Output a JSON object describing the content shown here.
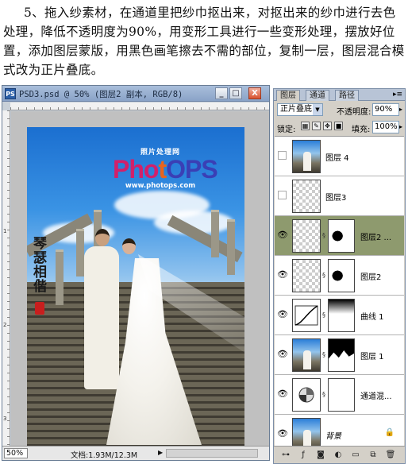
{
  "instruction": "5、拖入纱素材，在通道里把纱巾抠出来，对抠出来的纱巾进行去色处理，降低不透明度为90%，用变形工具进行一些变形处理，摆放好位置，添加图层蒙版，用黑色画笔擦去不需的部位，复制一层，图层混合模式改为正片叠底。",
  "document": {
    "icon_label": "PS",
    "title": "PSD3.psd @ 50% (图层2 副本, RGB/8)",
    "window_buttons": {
      "minimize": "_",
      "maximize": "□",
      "close": "X"
    },
    "rulers_top": [
      "2",
      "4",
      "6",
      "8",
      "10",
      "12",
      "14",
      "16",
      "18",
      "20",
      "22",
      "24",
      "26"
    ],
    "rulers_left": [
      "0",
      "1",
      "2",
      "3"
    ],
    "photo": {
      "logo_top": "照片处理网",
      "logo_main": [
        "Pho",
        "t",
        "OPS"
      ],
      "logo_url": "www.photops.com",
      "calligraphy": "琴瑟相偕"
    },
    "status": {
      "zoom": "50%",
      "doc_info": "文档:1.93M/12.3M",
      "arrow": "▶"
    }
  },
  "layers_panel": {
    "tabs": [
      "图层",
      "通道",
      "路径"
    ],
    "active_tab": 0,
    "menu_icon": "▸≡",
    "blend_mode": "正片叠底",
    "opacity_label": "不透明度:",
    "opacity": "90%",
    "lock_label": "锁定:",
    "fill_label": "填充:",
    "fill": "100%",
    "layers": [
      {
        "name": "图层 4",
        "visible": false,
        "thumb": "photo",
        "mask": null,
        "selected": false,
        "italic": false,
        "locked": false
      },
      {
        "name": "图层3",
        "visible": false,
        "thumb": "checker",
        "mask": null,
        "selected": false,
        "italic": false,
        "locked": false
      },
      {
        "name": "图层2 ...",
        "visible": true,
        "thumb": "checker",
        "mask": "black-veil",
        "selected": true,
        "italic": false,
        "locked": false
      },
      {
        "name": "图层2",
        "visible": true,
        "thumb": "checker",
        "mask": "black-veil",
        "selected": false,
        "italic": false,
        "locked": false
      },
      {
        "name": "曲线 1",
        "visible": true,
        "thumb": "curves",
        "mask": "grad",
        "selected": false,
        "italic": false,
        "locked": false
      },
      {
        "name": "图层 1",
        "visible": true,
        "thumb": "photo",
        "mask": "silhouette",
        "selected": false,
        "italic": false,
        "locked": false
      },
      {
        "name": "通道混...",
        "visible": true,
        "thumb": "mixer",
        "mask": "white",
        "selected": false,
        "italic": false,
        "locked": false
      },
      {
        "name": "背景",
        "visible": true,
        "thumb": "photo",
        "mask": null,
        "selected": false,
        "italic": true,
        "locked": true
      }
    ],
    "bottom_icons": [
      "link-icon",
      "fx-icon",
      "mask-icon",
      "adjustment-icon",
      "folder-icon",
      "new-layer-icon",
      "trash-icon"
    ]
  }
}
